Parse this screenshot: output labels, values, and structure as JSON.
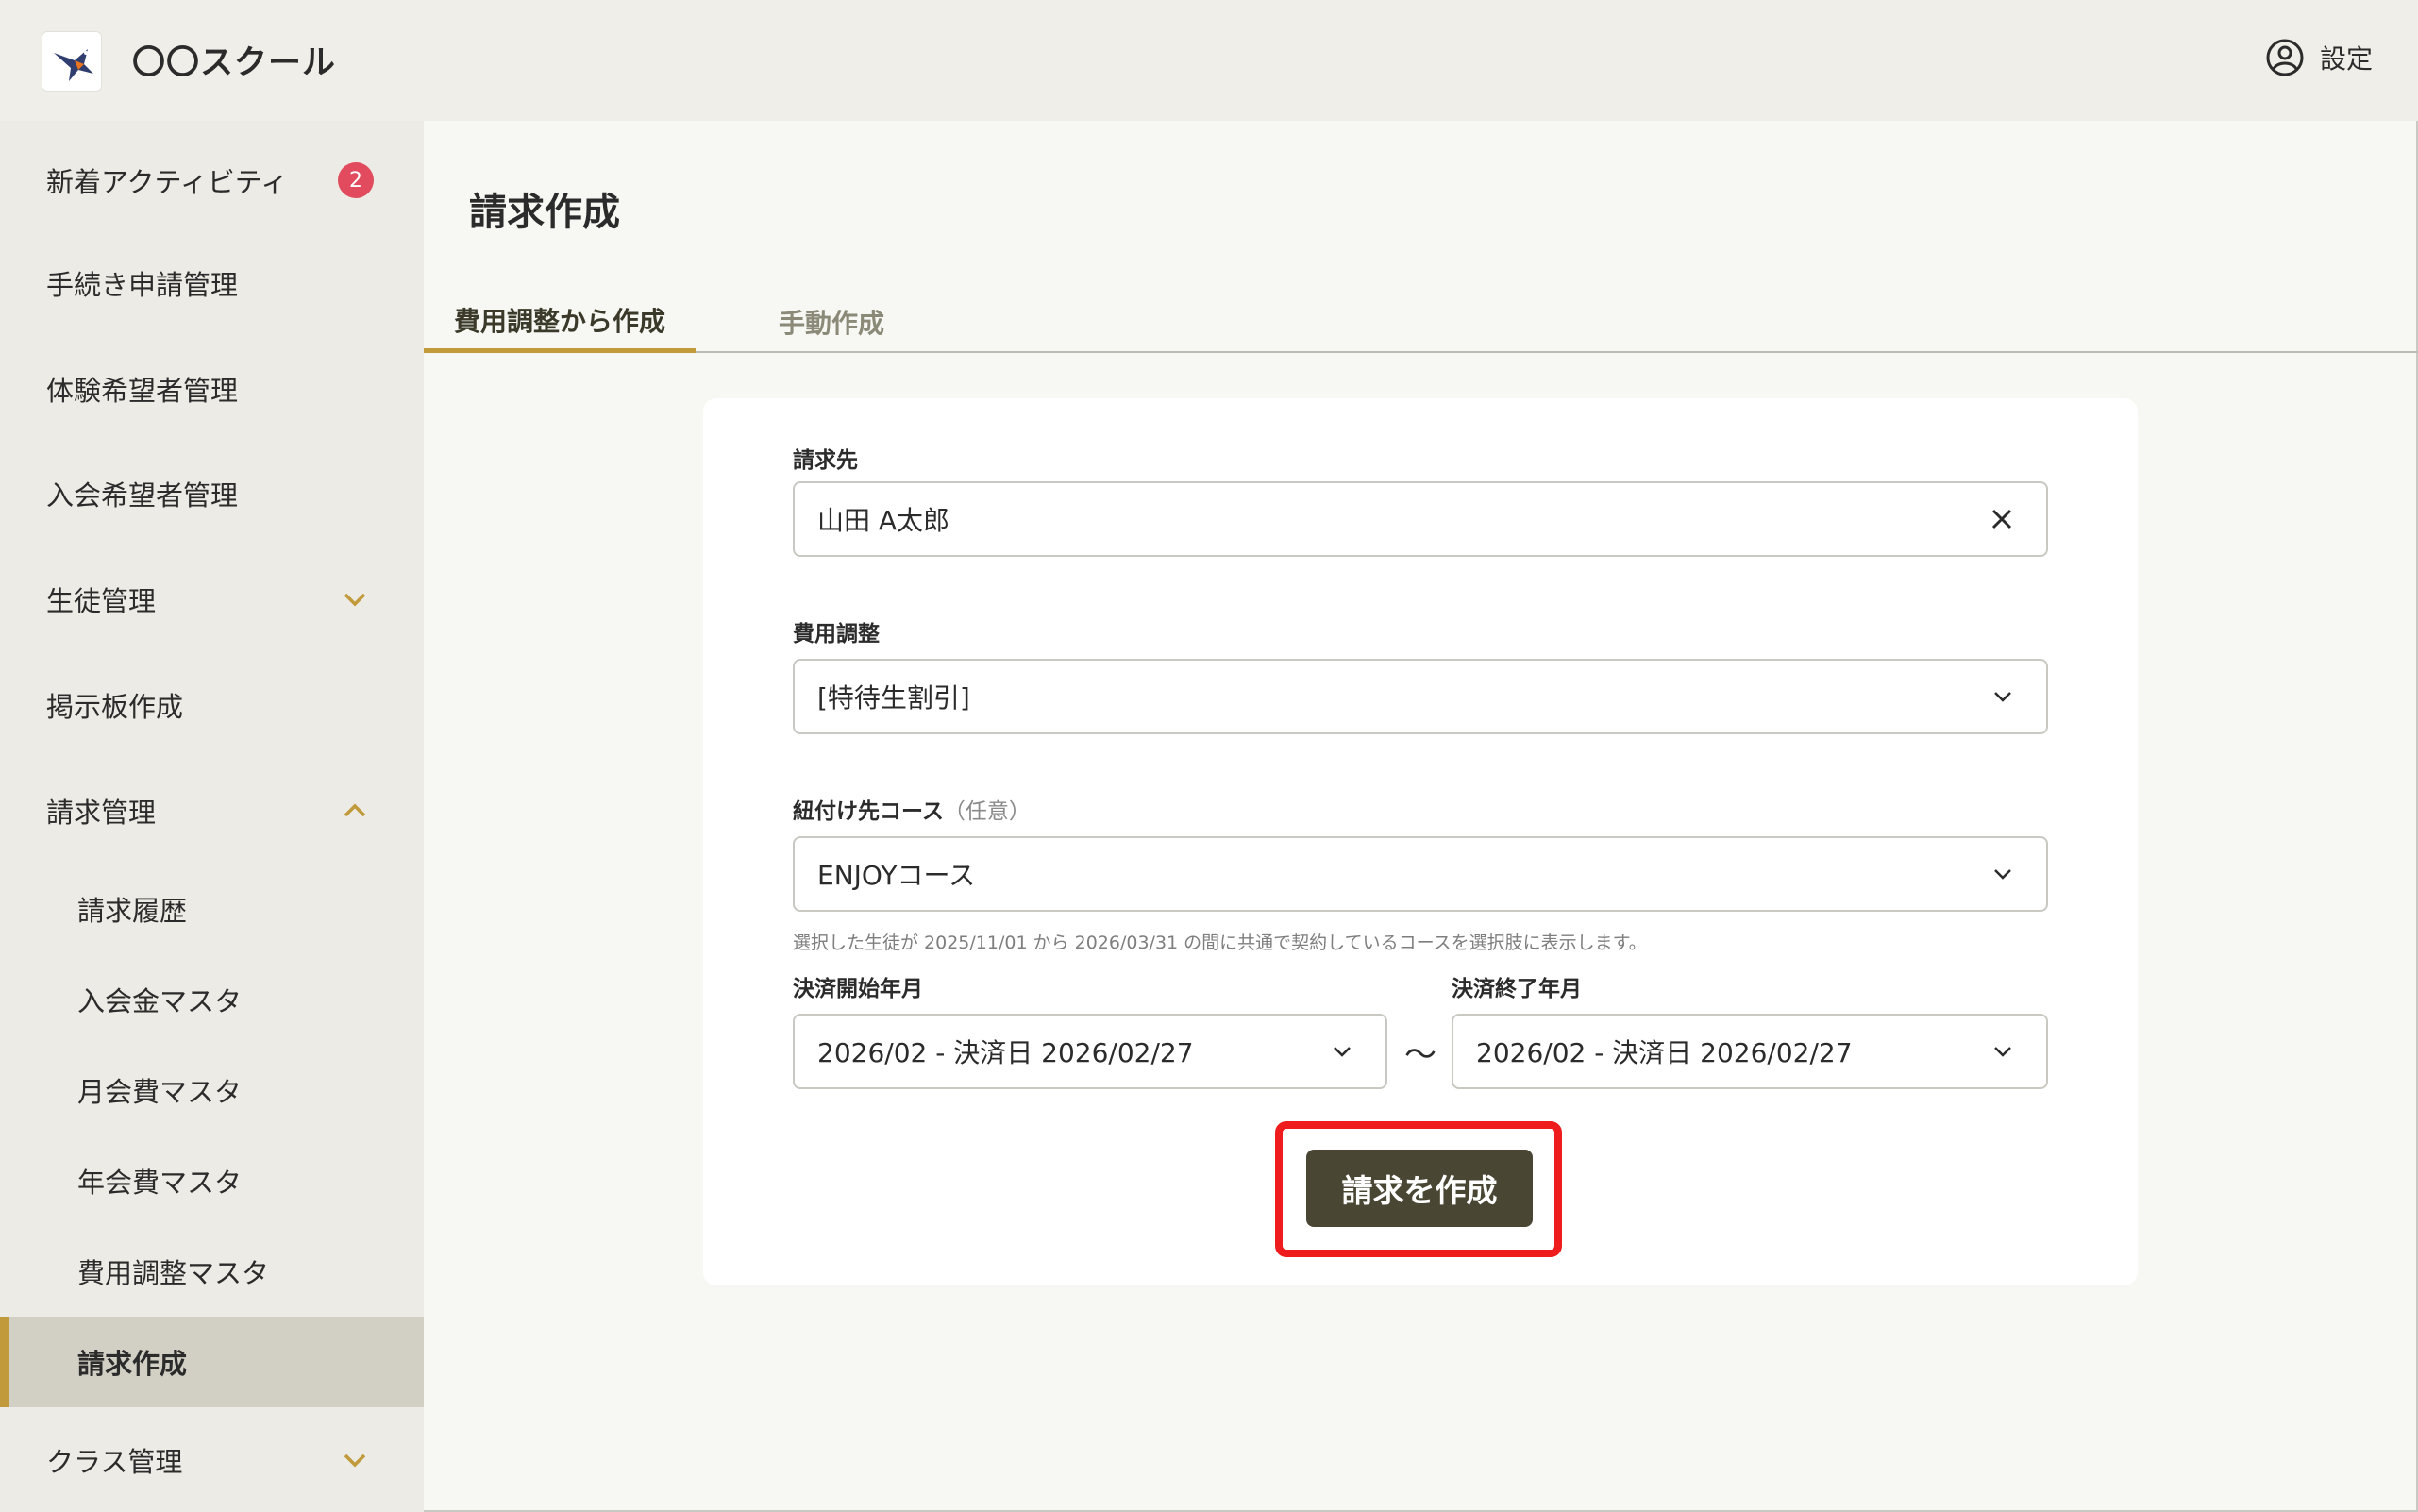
{
  "header": {
    "school_name": "〇〇スクール",
    "settings_label": "設定"
  },
  "sidebar": {
    "items": [
      {
        "label": "新着アクティビティ",
        "badge": "2"
      },
      {
        "label": "手続き申請管理"
      },
      {
        "label": "体験希望者管理"
      },
      {
        "label": "入会希望者管理"
      },
      {
        "label": "生徒管理",
        "chevron": "down"
      },
      {
        "label": "掲示板作成"
      },
      {
        "label": "請求管理",
        "chevron": "up"
      },
      {
        "label": "請求履歴"
      },
      {
        "label": "入会金マスタ"
      },
      {
        "label": "月会費マスタ"
      },
      {
        "label": "年会費マスタ"
      },
      {
        "label": "費用調整マスタ"
      },
      {
        "label": "請求作成",
        "active": true
      },
      {
        "label": "クラス管理",
        "chevron": "down"
      }
    ]
  },
  "main": {
    "title": "請求作成",
    "tabs": [
      {
        "label": "費用調整から作成",
        "active": true
      },
      {
        "label": "手動作成"
      }
    ],
    "form": {
      "billing_to_label": "請求先",
      "billing_to_value": "山田 A太郎",
      "adjustment_label": "費用調整",
      "adjustment_value": "[特待生割引]",
      "course_label": "紐付け先コース",
      "course_optional": "（任意）",
      "course_value": "ENJOYコース",
      "course_hint": "選択した生徒が 2025/11/01 から 2026/03/31 の間に共通で契約しているコースを選択肢に表示します。",
      "start_label": "決済開始年月",
      "start_value": "2026/02 - 決済日 2026/02/27",
      "range_separator": "～",
      "end_label": "決済終了年月",
      "end_value": "2026/02 - 決済日 2026/02/27",
      "submit_label": "請求を作成"
    }
  },
  "colors": {
    "accent": "#c19a3c",
    "primary_button": "#4a4634",
    "badge": "#e24b5e",
    "highlight": "#ee1c1c"
  },
  "icons": {
    "logo": "bird-logo-icon",
    "settings": "user-circle-icon",
    "clear": "close-icon",
    "dropdown": "chevron-down-icon"
  }
}
